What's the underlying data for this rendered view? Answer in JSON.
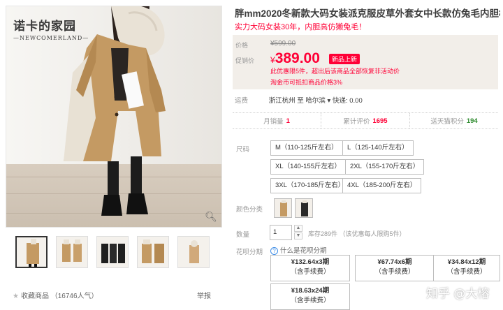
{
  "gallery": {
    "brand_cn": "诺卡的家园",
    "brand_en": "—NEWCOMERLAND—",
    "zoom_icon": "magnifier-icon",
    "thumb_count": 5
  },
  "actions": {
    "favorite_label": "收藏商品",
    "favorite_count": "（16746人气）",
    "report_label": "举报"
  },
  "product": {
    "title": "胖mm2020冬新款大码女装派克服皮草外套女中长款仿兔毛内胆棉大衣",
    "subtitle": "实力大码女装30年，内胆高仿獭兔毛！"
  },
  "price": {
    "list_label": "价格",
    "list_value": "¥599.00",
    "promo_label": "促销价",
    "currency": "¥",
    "promo_value": "389.00",
    "badge": "新品上新",
    "promo_note": "此优惠限5件，超出后该商品全部恢复非活动价",
    "coin_note": "淘金币可抵扣商品价格3%"
  },
  "shipping": {
    "label": "运费",
    "route": "浙江杭州 至 哈尔滨 ▾ 快递: 0.00"
  },
  "stats": {
    "sales_label": "月销量",
    "sales_value": "1",
    "reviews_label": "累计评价",
    "reviews_value": "1695",
    "points_label": "送天猫积分",
    "points_value": "194"
  },
  "sizes": {
    "label": "尺码",
    "options": [
      "M（110-125斤左右）",
      "L（125-140斤左右）",
      "XL（140-155斤左右）",
      "2XL（155-170斤左右）",
      "3XL（170-185斤左右）",
      "4XL（185-200斤左右）"
    ]
  },
  "colors": {
    "label": "颜色分类"
  },
  "quantity": {
    "label": "数量",
    "value": "1",
    "stock": "库存289件  （该优惠每人限购5件）"
  },
  "huabei": {
    "label": "花呗分期",
    "help": "什么是花呗分期",
    "options": [
      {
        "amount": "¥132.64x3期",
        "fee": "（含手续费）"
      },
      {
        "amount": "¥67.74x6期",
        "fee": "（含手续费）"
      },
      {
        "amount": "¥34.84x12期",
        "fee": "（含手续费）"
      },
      {
        "amount": "¥18.63x24期",
        "fee": "（含手续费）"
      }
    ]
  },
  "watermark": "知乎 @大榕",
  "colors_theme": {
    "accent": "#ff0036",
    "points": "#2e8b2e"
  }
}
